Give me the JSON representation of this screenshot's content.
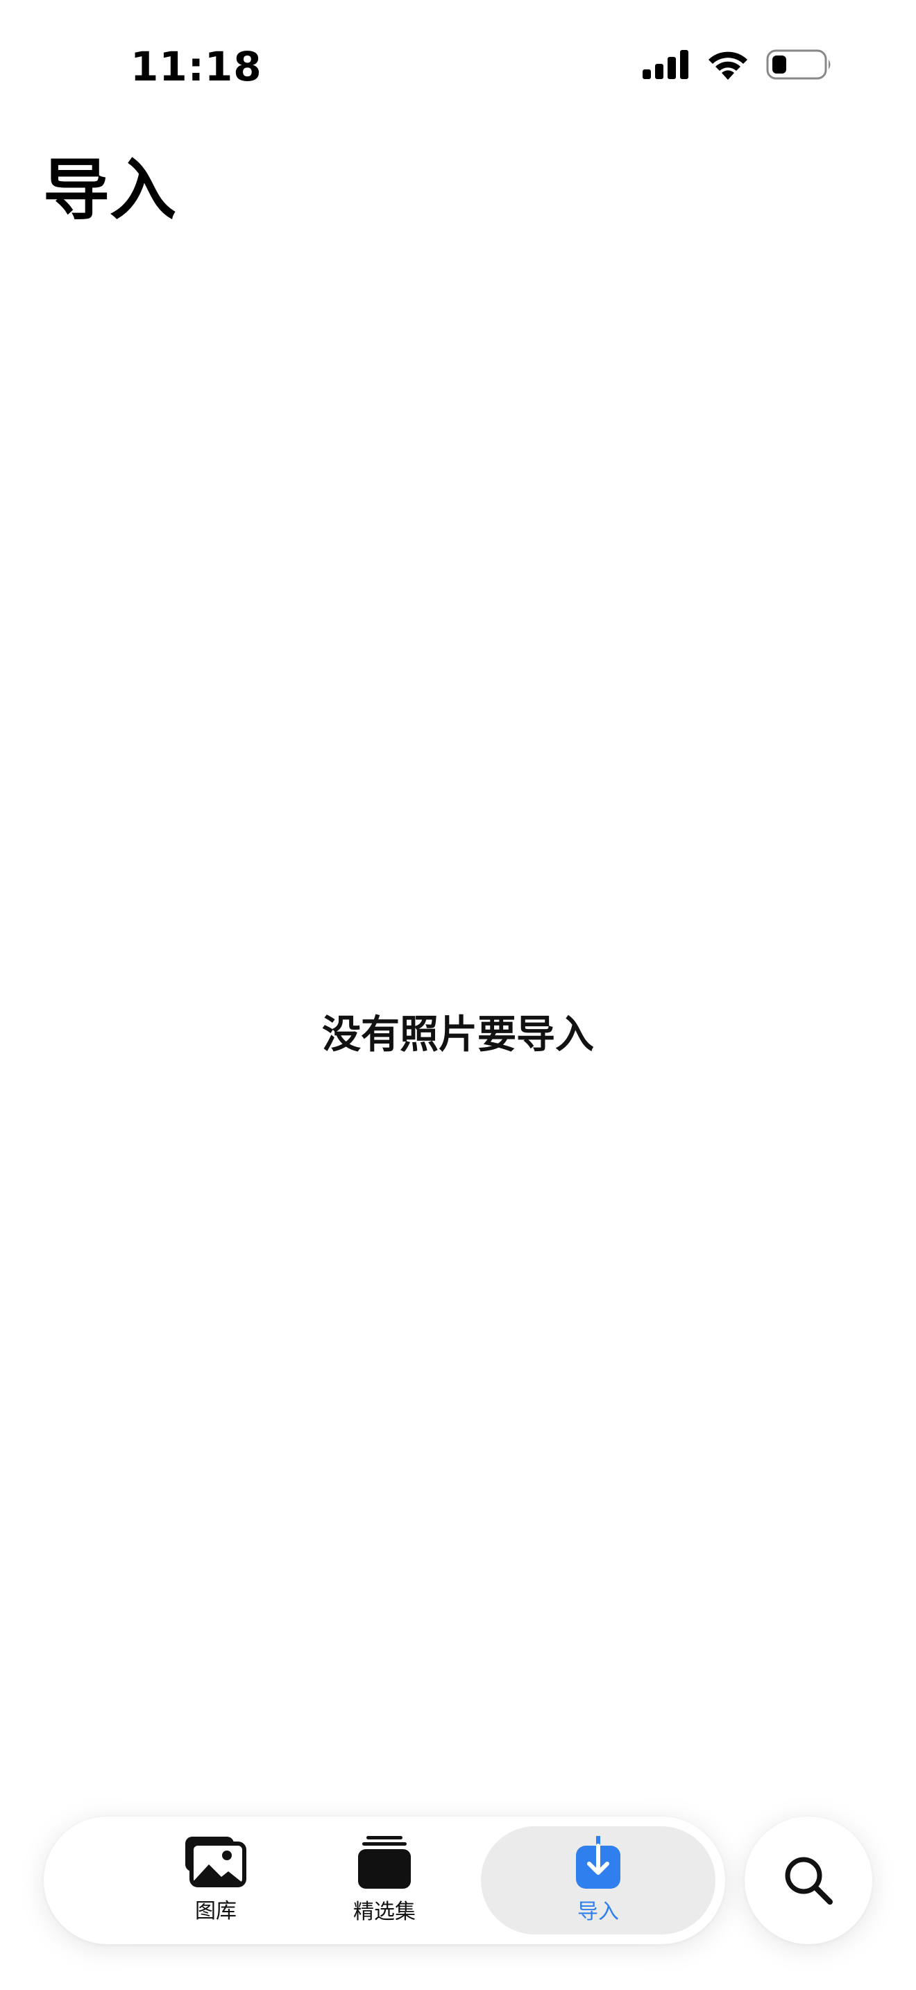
{
  "status_bar": {
    "time": "11:18"
  },
  "page": {
    "title": "导入",
    "empty_message": "没有照片要导入"
  },
  "tab_bar": {
    "tabs": [
      {
        "label": "图库",
        "icon": "photo-library-icon",
        "active": false
      },
      {
        "label": "精选集",
        "icon": "collections-stack-icon",
        "active": false
      },
      {
        "label": "导入",
        "icon": "import-download-icon",
        "active": true
      }
    ],
    "search_icon": "search-icon"
  },
  "colors": {
    "accent": "#2f80ee",
    "active_tab_bg": "#ebebeb",
    "text": "#000000"
  }
}
